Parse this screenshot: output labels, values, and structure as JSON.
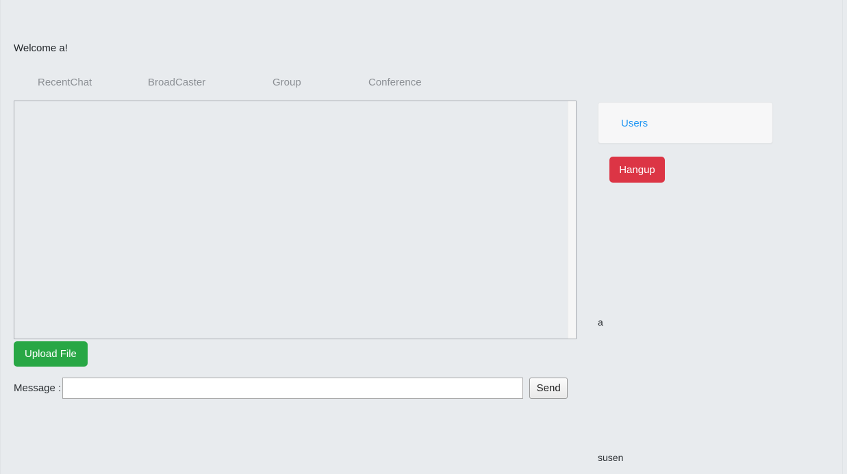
{
  "page": {
    "background_color": "#e8ebee",
    "welcome_text": "Welcome a!"
  },
  "tabs": [
    {
      "label": "RecentChat",
      "active": false
    },
    {
      "label": "BroadCaster",
      "active": false
    },
    {
      "label": "Group",
      "active": false
    },
    {
      "label": "Conference",
      "active": false
    }
  ],
  "chat": {
    "messages": [],
    "empty_text": ""
  },
  "actions": {
    "upload_label": "Upload File",
    "upload_color": "#28a745",
    "send_label": "Send",
    "hangup_label": "Hangup",
    "hangup_color": "#dc3545"
  },
  "message_form": {
    "label": "Message :",
    "value": "",
    "placeholder": ""
  },
  "right_panel": {
    "users_card_label": "Users",
    "users_link_color": "#2196f3",
    "user_list": [
      {
        "name": "a"
      },
      {
        "name": "susen"
      }
    ]
  }
}
